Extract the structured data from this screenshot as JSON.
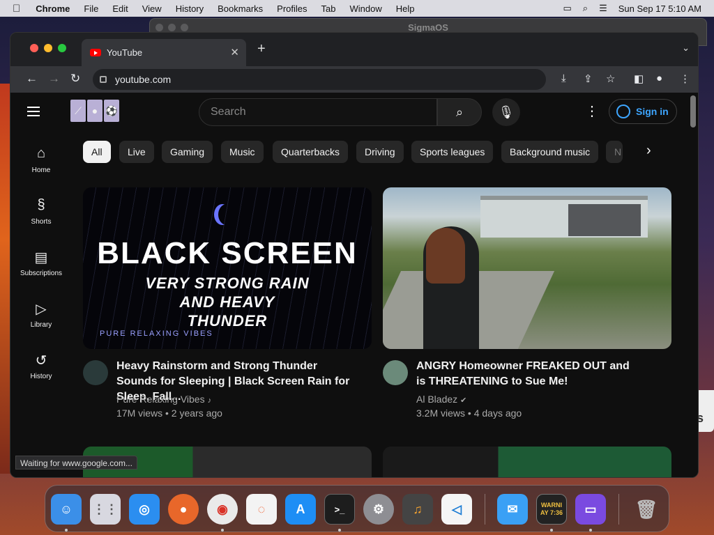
{
  "menubar": {
    "apple": "",
    "app": "Chrome",
    "items": [
      "File",
      "Edit",
      "View",
      "History",
      "Bookmarks",
      "Profiles",
      "Tab",
      "Window",
      "Help"
    ],
    "datetime": "Sun Sep 17  5:10 AM"
  },
  "background_window": {
    "title": "SigmaOS"
  },
  "right_window": {
    "text": "s"
  },
  "browser": {
    "tab": {
      "title": "YouTube",
      "close": "✕"
    },
    "new_tab": "+",
    "url": "youtube.com"
  },
  "youtube": {
    "search_placeholder": "Search",
    "sign_in": "Sign in",
    "guide": [
      {
        "label": "Home",
        "icon": "home-icon",
        "glyph": "⌂"
      },
      {
        "label": "Shorts",
        "icon": "shorts-icon",
        "glyph": "§"
      },
      {
        "label": "Subscriptions",
        "icon": "subscriptions-icon",
        "glyph": "▤"
      },
      {
        "label": "Library",
        "icon": "library-icon",
        "glyph": "▷"
      },
      {
        "label": "History",
        "icon": "history-icon",
        "glyph": "↺"
      }
    ],
    "chips": [
      "All",
      "Live",
      "Gaming",
      "Music",
      "Quarterbacks",
      "Driving",
      "Sports leagues",
      "Background music",
      "N"
    ],
    "videos": [
      {
        "thumb_title": "BLACK SCREEN",
        "thumb_subtitle": "VERY STRONG RAIN AND HEAVY THUNDER",
        "thumb_brand": "PURE RELAXING VIBES",
        "title": "Heavy Rainstorm and Strong Thunder Sounds for Sleeping | Black Screen Rain for Sleep, Fall...",
        "channel": "Pure Relaxing Vibes",
        "channel_badge": "♪",
        "meta": "17M views • 2 years ago"
      },
      {
        "title": "ANGRY Homeowner FREAKED OUT and is THREATENING to Sue Me!",
        "channel": "Al Bladez",
        "channel_badge": "✔",
        "meta": "3.2M views • 4 days ago"
      }
    ],
    "status": "Waiting for www.google.com..."
  },
  "dock": {
    "apps": [
      {
        "name": "Finder",
        "icon": "finder-icon",
        "glyph": "☺",
        "color": "#3b8fe8"
      },
      {
        "name": "Launchpad",
        "icon": "launchpad-icon",
        "glyph": "⋮⋮",
        "color": "#d8d8e0"
      },
      {
        "name": "Safari",
        "icon": "safari-icon",
        "glyph": "◎",
        "color": "#2b8ef0"
      },
      {
        "name": "Firefox",
        "icon": "firefox-icon",
        "glyph": "●",
        "color": "#e8672a"
      },
      {
        "name": "Chrome",
        "icon": "chrome-icon",
        "glyph": "◉",
        "color": "#eaeaea"
      },
      {
        "name": "Camo",
        "icon": "camo-icon",
        "glyph": "◌",
        "color": "#f3f3f3"
      },
      {
        "name": "App Store",
        "icon": "app-store-icon",
        "glyph": "A",
        "color": "#1e8ef5"
      },
      {
        "name": "Terminal",
        "icon": "terminal-icon",
        "glyph": ">_",
        "color": "#1d1d1d"
      },
      {
        "name": "System Settings",
        "icon": "settings-icon",
        "glyph": "⚙",
        "color": "#8e8e93"
      },
      {
        "name": "GarageBand",
        "icon": "garageband-icon",
        "glyph": "♫",
        "color": "#444"
      },
      {
        "name": "VS Code",
        "icon": "vscode-icon",
        "glyph": "◁",
        "color": "#f5f5f5"
      },
      {
        "name": "Mail",
        "icon": "mail-icon",
        "glyph": "✉",
        "color": "#3aa0f5"
      },
      {
        "name": "Console",
        "icon": "console-icon",
        "glyph": "WARNI AY 7:36",
        "color": "#222"
      },
      {
        "name": "Simulator",
        "icon": "simulator-icon",
        "glyph": "▭",
        "color": "#7a4ae0"
      },
      {
        "name": "Trash",
        "icon": "trash-icon",
        "glyph": "🗑",
        "color": "transparent"
      }
    ]
  }
}
